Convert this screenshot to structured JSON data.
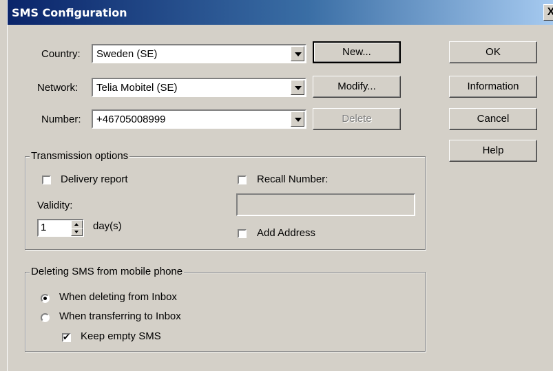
{
  "window": {
    "title": "SMS Configuration",
    "close_label": "X"
  },
  "labels": {
    "country": "Country:",
    "network": "Network:",
    "number": "Number:"
  },
  "combos": {
    "country": "Sweden (SE)",
    "network": "Telia Mobitel (SE)",
    "number": "+46705008999"
  },
  "buttons": {
    "new": "New...",
    "modify": "Modify...",
    "delete": "Delete",
    "ok": "OK",
    "information": "Information",
    "cancel": "Cancel",
    "help": "Help"
  },
  "transmission": {
    "legend": "Transmission options",
    "delivery_report": "Delivery report",
    "validity_label": "Validity:",
    "validity_value": "1",
    "validity_unit": "day(s)",
    "recall_number": "Recall Number:",
    "recall_value": "",
    "add_address": "Add Address"
  },
  "deleting": {
    "legend": "Deleting SMS from mobile phone",
    "opt_inbox": "When deleting from Inbox",
    "opt_transfer": "When transferring to Inbox",
    "keep_empty": "Keep empty SMS"
  }
}
